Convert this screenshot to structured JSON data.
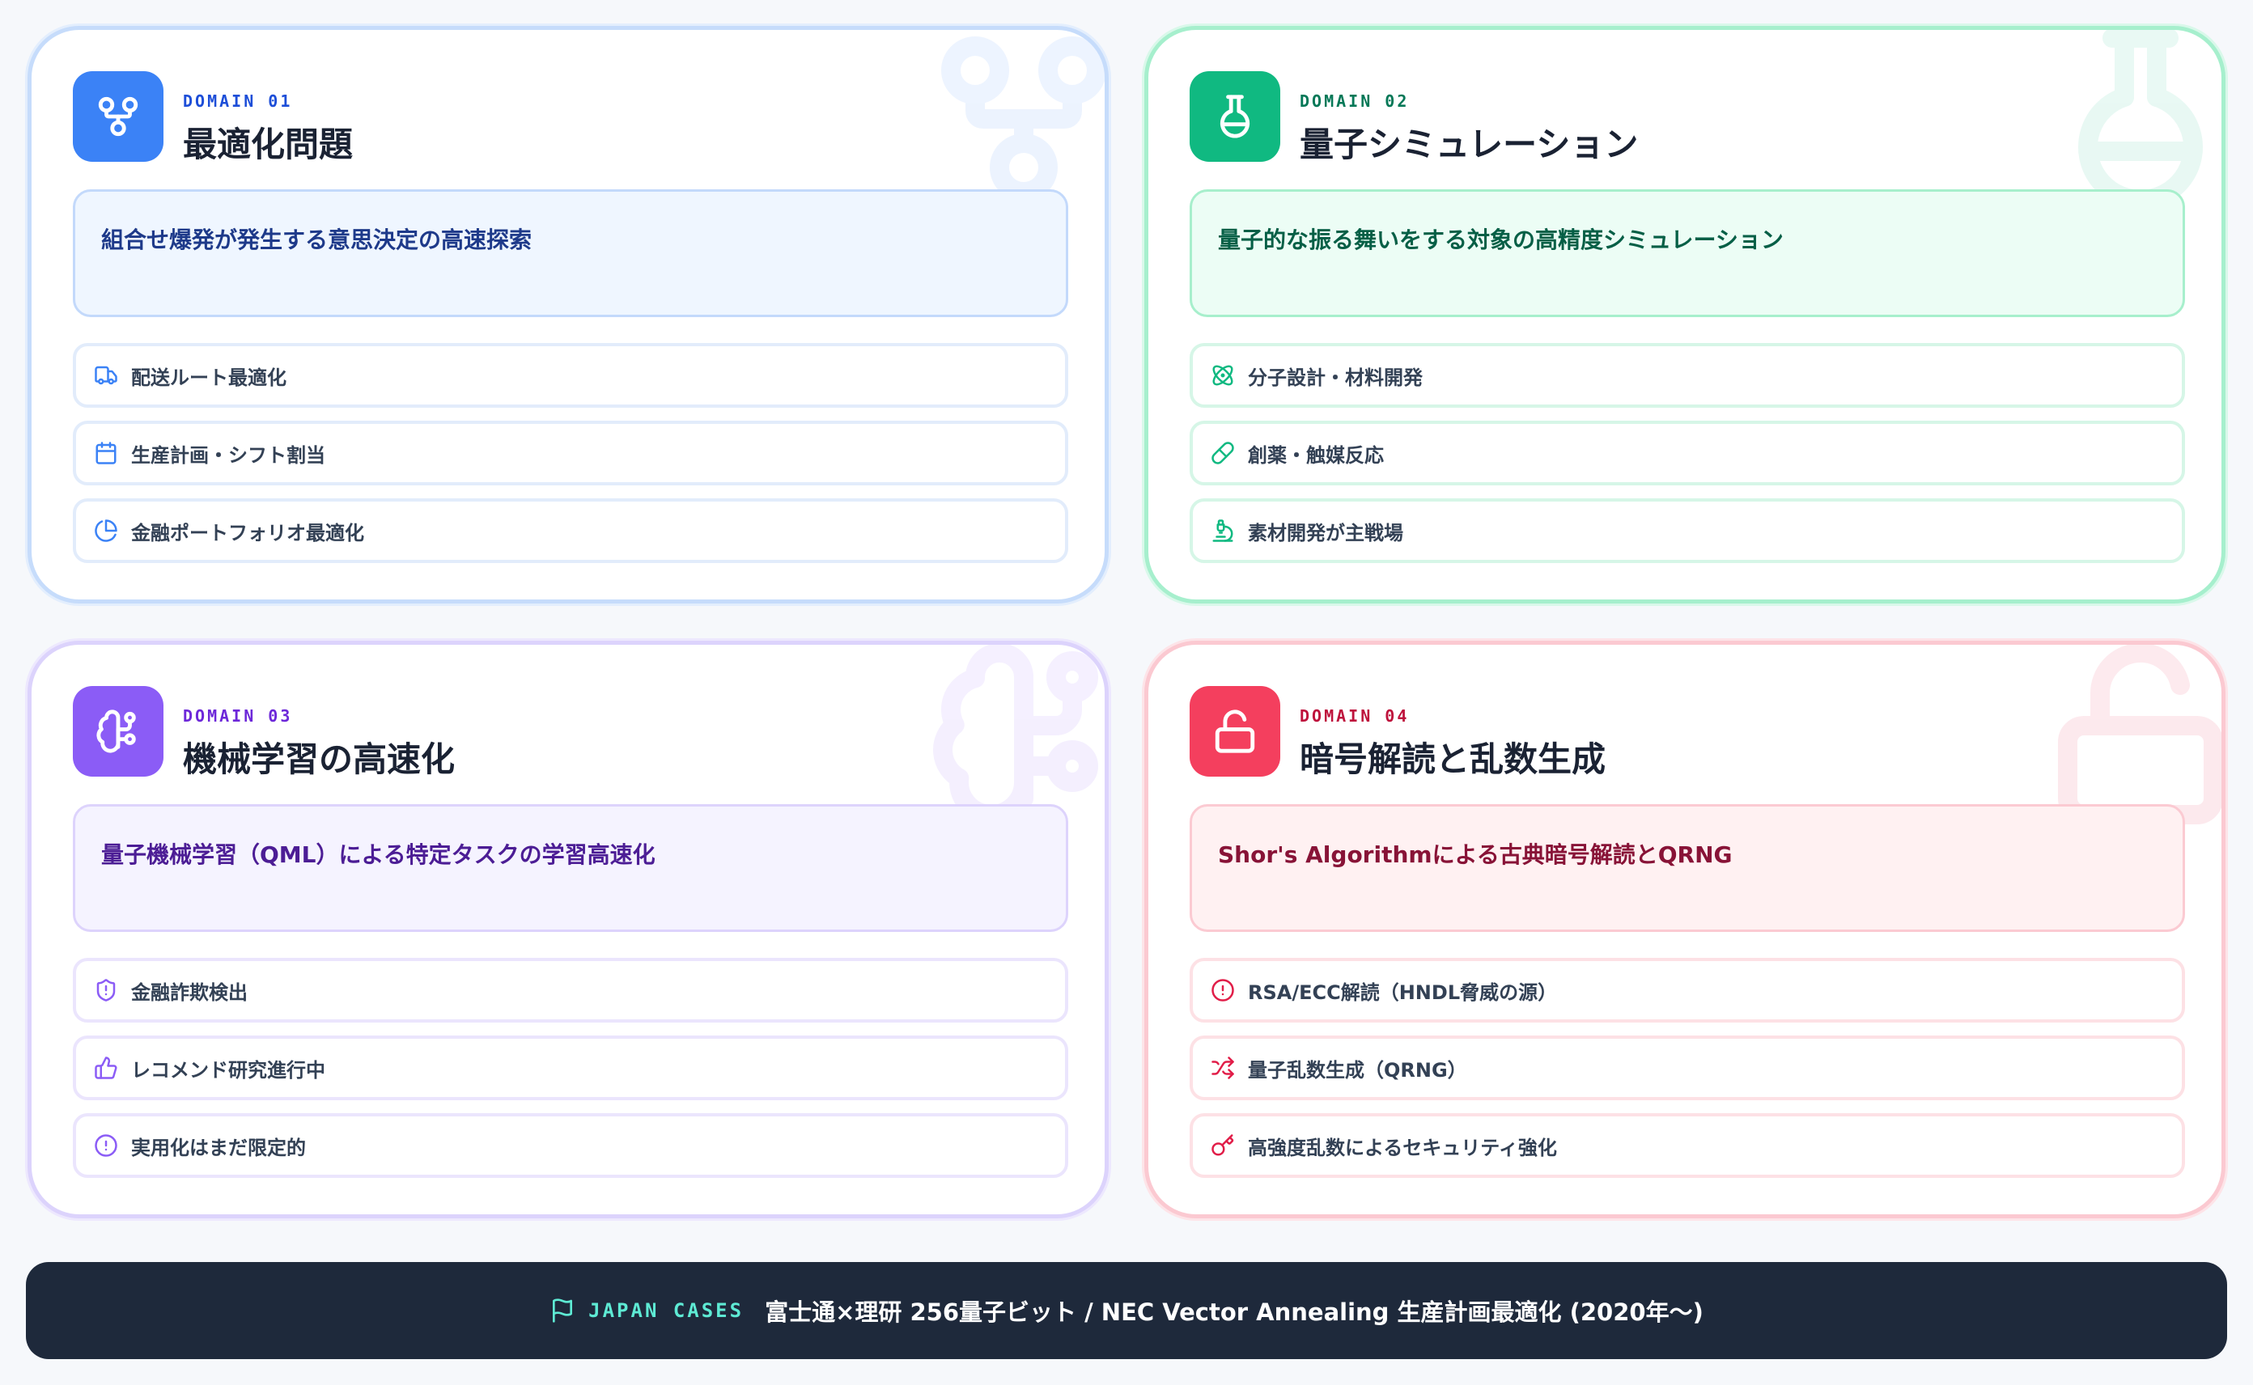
{
  "cards": [
    {
      "domain_label": "DOMAIN 01",
      "title": "最適化問題",
      "description": "組合せ爆発が発生する意思決定の高速探索",
      "icon": "git-fork-icon",
      "accent": "#3b82f6",
      "items": [
        {
          "label": "配送ルート最適化",
          "icon": "truck-icon"
        },
        {
          "label": "生産計画・シフト割当",
          "icon": "calendar-icon"
        },
        {
          "label": "金融ポートフォリオ最適化",
          "icon": "pie-chart-icon"
        }
      ]
    },
    {
      "domain_label": "DOMAIN 02",
      "title": "量子シミュレーション",
      "description": "量子的な振る舞いをする対象の高精度シミュレーション",
      "icon": "flask-icon",
      "accent": "#10b981",
      "items": [
        {
          "label": "分子設計・材料開発",
          "icon": "atom-icon"
        },
        {
          "label": "創薬・触媒反応",
          "icon": "pill-icon"
        },
        {
          "label": "素材開発が主戦場",
          "icon": "microscope-icon"
        }
      ]
    },
    {
      "domain_label": "DOMAIN 03",
      "title": "機械学習の高速化",
      "description": "量子機械学習（QML）による特定タスクの学習高速化",
      "icon": "brain-icon",
      "accent": "#8b5cf6",
      "items": [
        {
          "label": "金融詐欺検出",
          "icon": "shield-alert-icon"
        },
        {
          "label": "レコメンド研究進行中",
          "icon": "thumbs-up-icon"
        },
        {
          "label": "実用化はまだ限定的",
          "icon": "alert-circle-icon"
        }
      ]
    },
    {
      "domain_label": "DOMAIN 04",
      "title": "暗号解読と乱数生成",
      "description": "Shor's Algorithmによる古典暗号解読とQRNG",
      "icon": "lock-open-icon",
      "accent": "#f43f5e",
      "items": [
        {
          "label": "RSA/ECC解読（HNDL脅威の源）",
          "icon": "alert-circle-icon"
        },
        {
          "label": "量子乱数生成（QRNG）",
          "icon": "shuffle-icon"
        },
        {
          "label": "高強度乱数によるセキュリティ強化",
          "icon": "key-icon"
        }
      ]
    }
  ],
  "footer": {
    "label": "JAPAN CASES",
    "text": "富士通×理研 256量子ビット / NEC Vector Annealing 生産計画最適化 (2020年〜)",
    "icon": "flag-icon"
  }
}
